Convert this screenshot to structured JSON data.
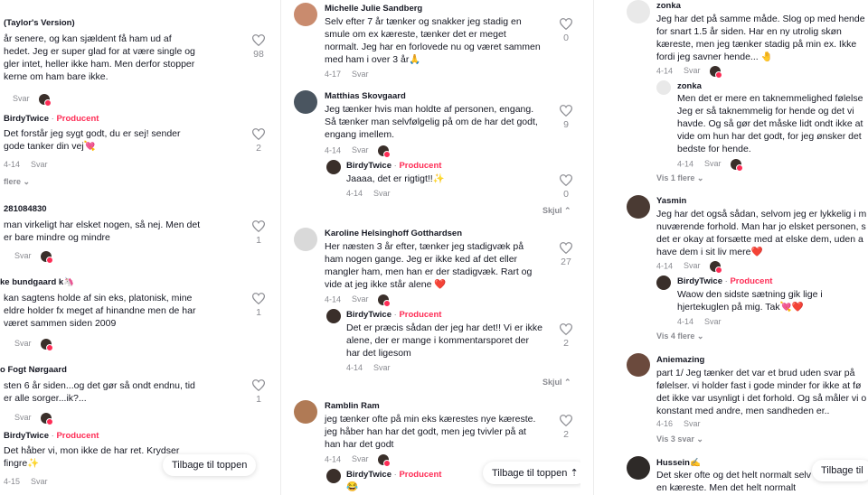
{
  "common": {
    "reply": "Svar",
    "producer": "Producent",
    "dot": " · "
  },
  "col1": {
    "c1": {
      "name": "(Taylor's Version)",
      "text": "år senere, og kan sjældent få ham ud af\nhedet. Jeg er super glad for at være single og\ngler intet, heller ikke ham. Men derfor stopper\nkerne om ham bare ikke.",
      "likes": "98"
    },
    "r1": {
      "name": "BirdyTwice",
      "text": "Det forstår jeg sygt godt, du er sej! sender\ngode tanker din vej💘",
      "date": "4-14",
      "likes": "2"
    },
    "more1": "flere",
    "c2": {
      "name": "281084830",
      "text": "man virkeligt har elsket nogen, så nej. Men det\ner bare mindre og mindre",
      "likes": "1"
    },
    "c3": {
      "name": "ke bundgaard k🦄",
      "text": "kan sagtens holde af sin eks, platonisk, mine\neldre holder fx meget af hinandne men de har\nværet sammen siden 2009",
      "likes": "1"
    },
    "c4": {
      "name": "o Fogt Nørgaard",
      "text": "sten 6 år siden...og det gør så ondt endnu, tid\ner alle sorger...ik?...",
      "likes": "1"
    },
    "r4": {
      "name": "BirdyTwice",
      "text": "Det håber vi, mon ikke de har ret. Krydser\nfingre✨",
      "date": "4-15"
    },
    "totop": "Tilbage til toppen"
  },
  "col2": {
    "c1": {
      "name": "Michelle Julie Sandberg",
      "text": "Selv efter 7 år tænker og snakker jeg stadig en\nsmule om ex kæreste, tænker det er meget\nnormalt. Jeg har en forlovede nu og været sammen\nmed ham i over 3 år🙏",
      "date": "4-17",
      "likes": "0"
    },
    "c2": {
      "name": "Matthias Skovgaard",
      "text": "Jeg tænker hvis man holdte af personen, engang.\nSå tænker man selvfølgelig på om de har det godt,\nengang imellem.",
      "date": "4-14",
      "likes": "9"
    },
    "r2": {
      "name": "BirdyTwice",
      "text": "Jaaaa, det er rigtigt!!✨",
      "date": "4-14",
      "likes": "0"
    },
    "hide2": "Skjul",
    "c3": {
      "name": "Karoline Helsinghoff Gotthardsen",
      "text": "Her næsten 3 år efter, tænker jeg stadigvæk på\nham nogen gange. Jeg er ikke ked af det eller\nmangler ham, men han er der stadigvæk. Rart og\nvide at jeg ikke står alene ❤️",
      "date": "4-14",
      "likes": "27"
    },
    "r3": {
      "name": "BirdyTwice",
      "text": "Det er præcis sådan der jeg har det!! Vi er ikke\nalene, der er mange i kommentarsporet der\nhar det ligesom",
      "date": "4-14",
      "likes": "2"
    },
    "hide3": "Skjul",
    "c4": {
      "name": "Ramblin Ram",
      "text": "jeg tænker ofte på min eks kærestes nye kæreste.\njeg håber han har det godt, men jeg tvivler på at\nhan har det godt",
      "date": "4-14",
      "likes": "2"
    },
    "r4": {
      "name": "BirdyTwice",
      "text": "😂"
    },
    "totop": "Tilbage til toppen"
  },
  "col3": {
    "c1": {
      "name": "zonka",
      "text": "Jeg har det på samme måde. Slog op med hende\nfor snart 1.5 år siden. Har en ny utrolig skøn\nkæreste, men jeg tænker stadig på min ex. Ikke\nfordi jeg savner hende... 🤚",
      "date": "4-14"
    },
    "r1": {
      "name": "zonka",
      "text": "Men det er mere en taknemmelighed følelse\nJeg er så taknemmelig for hende og det vi\nhavde. Og så gør det måske lidt ondt ikke at\nvide om hun har det godt, for jeg ønsker det\nbedste for hende.",
      "date": "4-14"
    },
    "more1": "Vis 1 flere",
    "c2": {
      "name": "Yasmin",
      "text": "Jeg har det også sådan, selvom jeg er lykkelig i m\nnuværende forhold. Man har jo elsket personen, s\ndet er okay at forsætte med at elske dem, uden a\nhave dem i sit liv mere❤️",
      "date": "4-14"
    },
    "r2": {
      "name": "BirdyTwice",
      "text": "Waow den sidste sætning gik lige i\nhjertekuglen på mig. Tak💘❤️",
      "date": "4-14"
    },
    "more2": "Vis 4 flere",
    "c3": {
      "name": "Aniemazing",
      "text": "part 1/ Jeg tænker det var et brud uden svar på\nfølelser. vi holder fast i gode minder for ikke at fø\ndet ikke var usynligt i det forhold. Og så måler vi o\nkonstant med andre, men sandheden er..",
      "date": "4-16"
    },
    "more3": "Vis 3 svar",
    "c4": {
      "name": "Hussein✍️",
      "text": "Det sker ofte og det helt normalt selv\nen kæreste. Men det helt normalt"
    },
    "totop": "Tilbage til"
  }
}
